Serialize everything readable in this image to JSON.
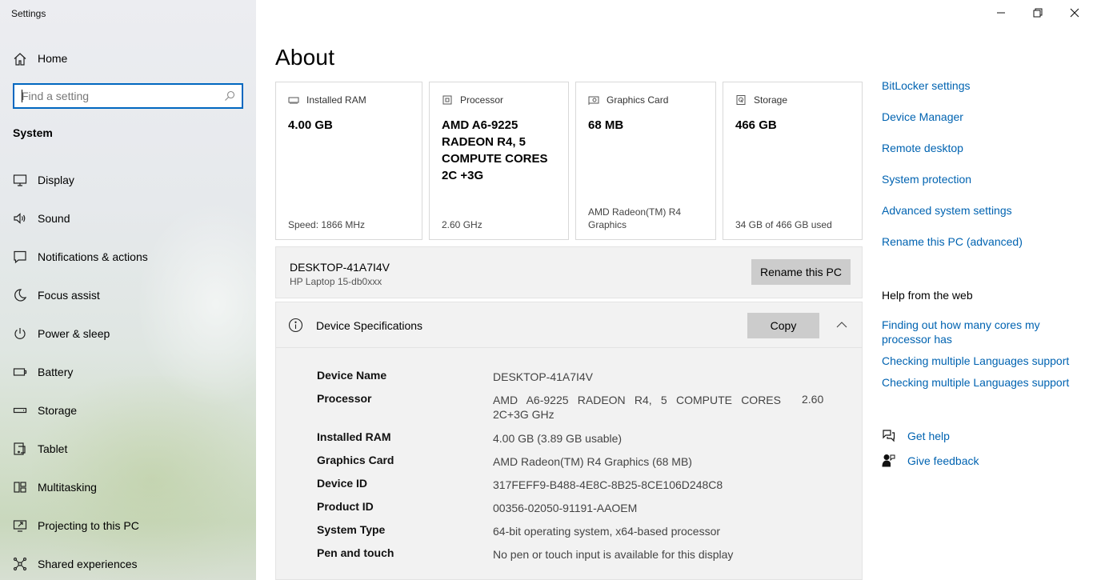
{
  "window": {
    "title": "Settings",
    "controls": [
      "minimize-icon",
      "restore-icon",
      "close-icon"
    ]
  },
  "sidebar": {
    "home_label": "Home",
    "search_placeholder": "Find a setting",
    "section_label": "System",
    "items": [
      {
        "label": "Display",
        "icon": "display-icon"
      },
      {
        "label": "Sound",
        "icon": "sound-icon"
      },
      {
        "label": "Notifications & actions",
        "icon": "notifications-icon"
      },
      {
        "label": "Focus assist",
        "icon": "focus-assist-icon"
      },
      {
        "label": "Power & sleep",
        "icon": "power-icon"
      },
      {
        "label": "Battery",
        "icon": "battery-icon"
      },
      {
        "label": "Storage",
        "icon": "storage-icon"
      },
      {
        "label": "Tablet",
        "icon": "tablet-icon"
      },
      {
        "label": "Multitasking",
        "icon": "multitasking-icon"
      },
      {
        "label": "Projecting to this PC",
        "icon": "projecting-icon"
      },
      {
        "label": "Shared experiences",
        "icon": "shared-experiences-icon"
      }
    ]
  },
  "main": {
    "title": "About",
    "cards": [
      {
        "label": "Installed RAM",
        "value": "4.00 GB",
        "footer": "Speed: 1866 MHz",
        "icon": "ram-icon"
      },
      {
        "label": "Processor",
        "value": "AMD A6-9225 RADEON R4, 5 COMPUTE CORES 2C +3G",
        "footer": "2.60 GHz",
        "icon": "processor-icon"
      },
      {
        "label": "Graphics Card",
        "value": "68 MB",
        "footer": "AMD Radeon(TM) R4 Graphics",
        "icon": "graphics-card-icon"
      },
      {
        "label": "Storage",
        "value": "466 GB",
        "footer": "34 GB of 466 GB used",
        "icon": "storage-drive-icon"
      }
    ],
    "pc": {
      "name": "DESKTOP-41A7I4V",
      "model": "HP Laptop 15-db0xxx",
      "rename_label": "Rename this PC"
    },
    "specs": {
      "title": "Device Specifications",
      "copy_label": "Copy",
      "rows": [
        {
          "key": "Device Name",
          "value": "DESKTOP-41A7I4V"
        },
        {
          "key": "Processor",
          "value": "AMD A6-9225 RADEON R4, 5 COMPUTE CORES 2C+3G GHz",
          "value_extra": "2.60"
        },
        {
          "key": "Installed RAM",
          "value": "4.00 GB (3.89 GB usable)"
        },
        {
          "key": "Graphics Card",
          "value": "AMD Radeon(TM) R4 Graphics (68 MB)"
        },
        {
          "key": "Device ID",
          "value": "317FEFF9-B488-4E8C-8B25-8CE106D248C8"
        },
        {
          "key": "Product ID",
          "value": "00356-02050-91191-AAOEM"
        },
        {
          "key": "System Type",
          "value": "64-bit operating system, x64-based processor"
        },
        {
          "key": "Pen and touch",
          "value": "No pen or touch input is available for this display"
        }
      ]
    }
  },
  "related": {
    "links": [
      "BitLocker settings",
      "Device Manager",
      "Remote desktop",
      "System protection",
      "Advanced system settings",
      "Rename this PC (advanced)"
    ],
    "help_title": "Help from the web",
    "help_links": [
      "Finding out how many cores my processor has",
      "Checking multiple Languages support",
      "Checking multiple Languages support"
    ],
    "get_help": "Get help",
    "give_feedback": "Give feedback"
  },
  "colors": {
    "accent": "#0067c0",
    "link": "#0063b1",
    "button_bg": "#cccccc",
    "panel_bg": "#f2f2f2"
  }
}
